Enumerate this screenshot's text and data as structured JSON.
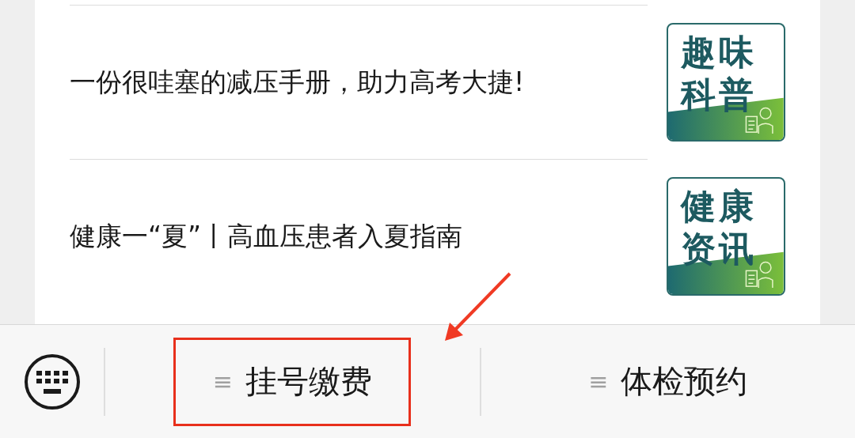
{
  "articles": [
    {
      "title": "一份很哇塞的减压手册，助力高考大捷!",
      "thumbnail": "趣味科普"
    },
    {
      "title": "健康一“夏”丨高血压患者入夏指南",
      "thumbnail": "健康资讯"
    }
  ],
  "menu_bar": {
    "items": [
      {
        "icon": "≡",
        "label": "挂号缴费",
        "highlighted": true
      },
      {
        "icon": "≡",
        "label": "体检预约",
        "highlighted": false
      }
    ]
  }
}
